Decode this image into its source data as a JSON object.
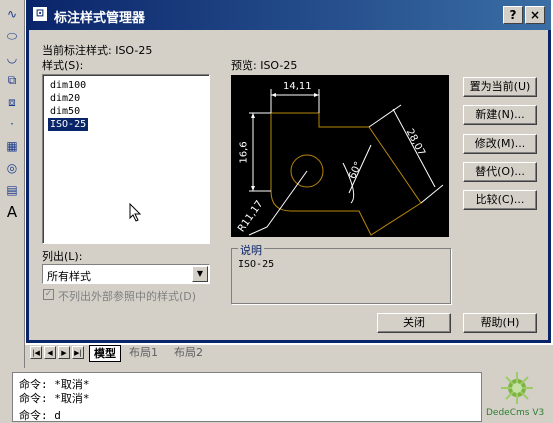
{
  "dialog": {
    "title": "标注样式管理器",
    "help_button": "?",
    "close_button": "×",
    "current_style_label": "当前标注样式: ISO-25",
    "styles_label": "样式(S):",
    "styles": [
      "dim100",
      "dim20",
      "dim50",
      "ISO-25"
    ],
    "selected_style": "ISO-25",
    "preview_label": "预览: ISO-25",
    "preview_dims": {
      "top": "14,11",
      "left": "16,6",
      "right": "28,07",
      "angle": "60°",
      "radius": "R11,17"
    },
    "buttons": {
      "set_current": "置为当前(U)",
      "new": "新建(N)...",
      "modify": "修改(M)...",
      "override": "替代(O)...",
      "compare": "比较(C)..."
    },
    "list_label": "列出(L):",
    "list_value": "所有样式",
    "xref_checkbox_label": "不列出外部参照中的样式(D)",
    "description_label": "说明",
    "description_text": "ISO-25",
    "close_label": "关闭",
    "help_label": "帮助(H)"
  },
  "layout_tabs": [
    "模型",
    "布局1",
    "布局2"
  ],
  "command_lines": [
    "命令: *取消*",
    "命令: *取消*",
    "命令: d"
  ],
  "logo_text": "DedeCms V3",
  "colors": {
    "titlebar": "#0a246a",
    "dialog_bg": "#d4d0c8",
    "preview_shape": "#b8860b",
    "preview_dim": "#ffffff"
  }
}
